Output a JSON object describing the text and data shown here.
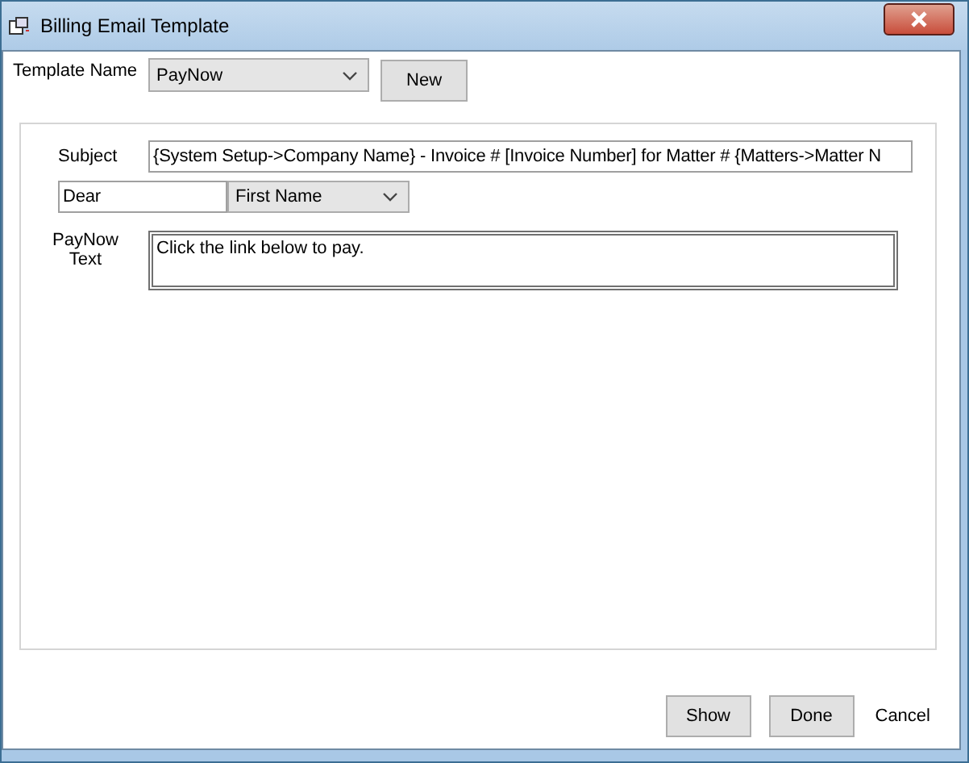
{
  "window": {
    "title": "Billing Email Template"
  },
  "template_name": {
    "label": "Template Name",
    "value": "PayNow"
  },
  "new_button": "New",
  "subject": {
    "label": "Subject",
    "value": "{System Setup->Company Name} - Invoice # [Invoice Number] for Matter  # {Matters->Matter N"
  },
  "greeting": {
    "value": "Dear",
    "name_field": "First Name"
  },
  "paynow_text": {
    "label": "PayNow Text",
    "value": "Click the link below to pay."
  },
  "buttons": [
    "Show",
    "Done",
    "Cancel"
  ]
}
